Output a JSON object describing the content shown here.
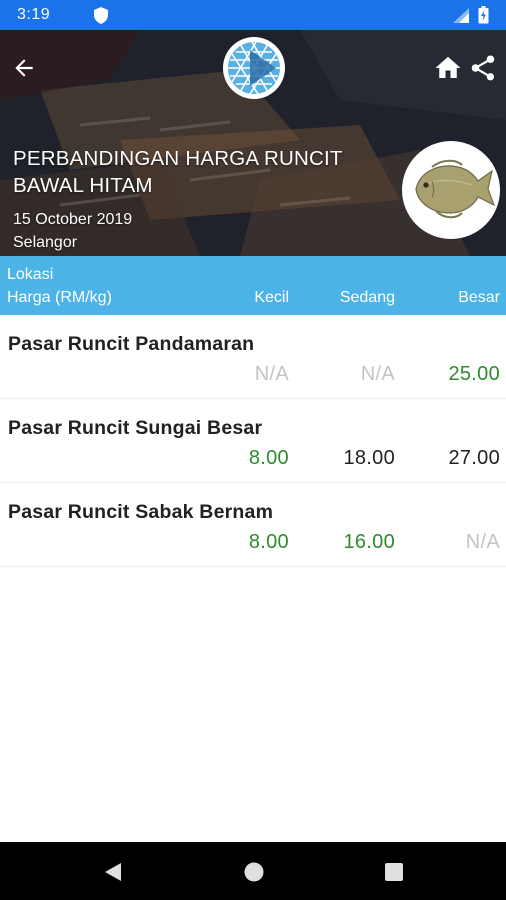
{
  "status_bar": {
    "time": "3:19",
    "icons": [
      "shield-icon",
      "signal-icon",
      "battery-icon"
    ]
  },
  "header": {
    "title_line1": "PERBANDINGAN HARGA RUNCIT",
    "title_line2": "BAWAL HITAM",
    "date": "15 October 2019",
    "state": "Selangor",
    "icons": [
      "back-arrow-icon",
      "agency-logo",
      "home-icon",
      "share-icon",
      "fish-image"
    ]
  },
  "table": {
    "header": {
      "location_label": "Lokasi",
      "price_label": "Harga (RM/kg)",
      "columns": [
        "Kecil",
        "Sedang",
        "Besar"
      ]
    },
    "rows": [
      {
        "name": "Pasar Runcit Pandamaran",
        "prices": [
          "N/A",
          "N/A",
          "25.00"
        ]
      },
      {
        "name": "Pasar Runcit Sungai Besar",
        "prices": [
          "8.00",
          "18.00",
          "27.00"
        ]
      },
      {
        "name": "Pasar Runcit Sabak Bernam",
        "prices": [
          "8.00",
          "16.00",
          "N/A"
        ]
      }
    ]
  },
  "colors": {
    "status_bar": "#1a73e8",
    "table_header": "#4cb3e6",
    "price_green": "#2e8b2e",
    "price_black": "#212121",
    "price_na": "#c4c4c4"
  },
  "nav_bar": {
    "icons": [
      "nav-back-icon",
      "nav-home-icon",
      "nav-recents-icon"
    ]
  }
}
